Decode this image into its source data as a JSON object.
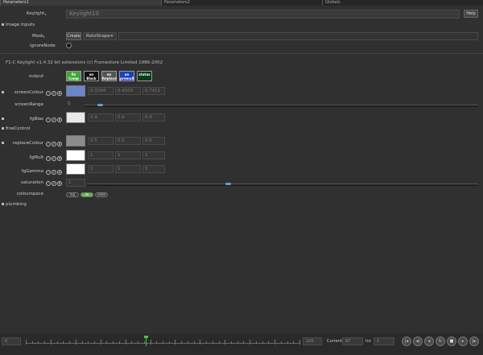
{
  "tabs": [
    "Parameters1",
    "Parameters2",
    "Globals"
  ],
  "node": {
    "label": "Keylight",
    "name": "Keylight10",
    "help": "Help"
  },
  "image_inputs": {
    "section": "Image Inputs",
    "mask_label": "Mask",
    "create_label": "Create",
    "mask_value": "RotoShape",
    "ignore_label": "ignoreNode"
  },
  "version_text": "F1-C Keylight v1.4.32 bit extensions (c) Framestore Limited 1986-2002",
  "output": {
    "label": "output",
    "options": [
      {
        "line1": "fin",
        "line2": "Comp",
        "bg": "#3ea63a"
      },
      {
        "line1": "on",
        "line2": "Black",
        "bg": "#111111"
      },
      {
        "line1": "on",
        "line2": "Replace",
        "bg": "#555555"
      },
      {
        "line1": "un",
        "line2": "premult",
        "bg": "#1a3fbf"
      },
      {
        "line1": "status",
        "line2": "",
        "bg": "#0a3a20"
      }
    ]
  },
  "screen_colour": {
    "label": "screenColour",
    "color": "#6b86c8",
    "values": [
      "0.3594",
      "0.4509",
      "0.7411"
    ]
  },
  "screen_range": {
    "label": "screenRange",
    "value": "0",
    "level": 0.04
  },
  "fg_bias": {
    "label": "fgBias",
    "color": "#e8e8e8",
    "values": [
      "0.9",
      "0.9",
      "0.9"
    ]
  },
  "fine_control": {
    "section": "fineControl"
  },
  "replace_colour": {
    "label": "replaceColour",
    "color": "#8c8c8c",
    "values": [
      "0.5",
      "0.5",
      "0.5"
    ]
  },
  "fg_mult": {
    "label": "fgMult",
    "color": "#ffffff",
    "values": [
      "1",
      "1",
      "1"
    ]
  },
  "fg_gamma": {
    "label": "fgGamma",
    "color": "#ffffff",
    "values": [
      "1",
      "1",
      "1"
    ]
  },
  "saturation": {
    "label": "saturation",
    "value": "1",
    "level": 0.36
  },
  "colourspace": {
    "label": "colourspace",
    "options": [
      "log",
      "lin",
      "video"
    ],
    "selected": "lin"
  },
  "plumbing": {
    "section": "plumbing"
  },
  "timeline": {
    "start": "0",
    "end": "220",
    "current_label": "Current",
    "current": "97",
    "inc_label": "Inc",
    "inc": "1",
    "playhead": 0.44
  }
}
